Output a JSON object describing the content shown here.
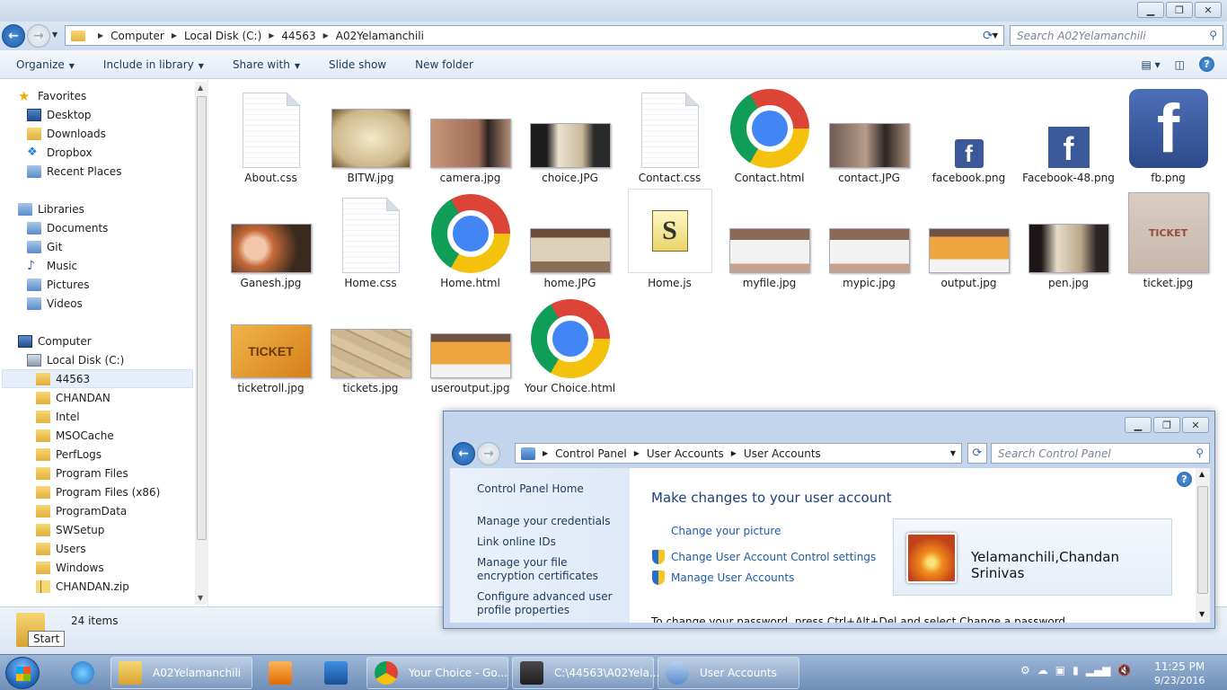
{
  "explorer": {
    "breadcrumbs": [
      "Computer",
      "Local Disk (C:)",
      "44563",
      "A02Yelamanchili"
    ],
    "search_placeholder": "Search A02Yelamanchili",
    "toolbar": {
      "organize": "Organize",
      "include_in_library": "Include in library",
      "share_with": "Share with",
      "slide_show": "Slide show",
      "new_folder": "New folder"
    },
    "nav": {
      "favorites": "Favorites",
      "desktop": "Desktop",
      "downloads": "Downloads",
      "dropbox": "Dropbox",
      "recent_places": "Recent Places",
      "libraries": "Libraries",
      "documents": "Documents",
      "git": "Git",
      "music": "Music",
      "pictures": "Pictures",
      "videos": "Videos",
      "computer": "Computer",
      "local_disk": "Local Disk (C:)",
      "folders": [
        "44563",
        "CHANDAN",
        "Intel",
        "MSOCache",
        "PerfLogs",
        "Program Files",
        "Program Files (x86)",
        "ProgramData",
        "SWSetup",
        "Users",
        "Windows",
        "CHANDAN.zip"
      ]
    },
    "files": [
      {
        "name": "About.css",
        "kind": "doc"
      },
      {
        "name": "BITW.jpg",
        "kind": "pic"
      },
      {
        "name": "camera.jpg",
        "kind": "pic"
      },
      {
        "name": "choice.JPG",
        "kind": "pic"
      },
      {
        "name": "Contact.css",
        "kind": "doc"
      },
      {
        "name": "Contact.html",
        "kind": "chrome"
      },
      {
        "name": "contact.JPG",
        "kind": "pic"
      },
      {
        "name": "facebook.png",
        "kind": "fbsm"
      },
      {
        "name": "Facebook-48.png",
        "kind": "fbmd"
      },
      {
        "name": "fb.png",
        "kind": "fblg"
      },
      {
        "name": "Ganesh.jpg",
        "kind": "pic"
      },
      {
        "name": "Home.css",
        "kind": "doc"
      },
      {
        "name": "Home.html",
        "kind": "chrome"
      },
      {
        "name": "home.JPG",
        "kind": "pic"
      },
      {
        "name": "Home.js",
        "kind": "js"
      },
      {
        "name": "myfile.jpg",
        "kind": "pic"
      },
      {
        "name": "mypic.jpg",
        "kind": "pic"
      },
      {
        "name": "output.jpg",
        "kind": "pic"
      },
      {
        "name": "pen.jpg",
        "kind": "pic"
      },
      {
        "name": "ticket.jpg",
        "kind": "pic"
      },
      {
        "name": "ticketroll.jpg",
        "kind": "ticket"
      },
      {
        "name": "tickets.jpg",
        "kind": "pic"
      },
      {
        "name": "useroutput.jpg",
        "kind": "pic"
      },
      {
        "name": "Your Choice.html",
        "kind": "chrome"
      }
    ],
    "item_count": "24 items",
    "tooltip": "Start"
  },
  "control_panel": {
    "breadcrumbs": [
      "Control Panel",
      "User Accounts",
      "User Accounts"
    ],
    "search_placeholder": "Search Control Panel",
    "side_links": {
      "home": "Control Panel Home",
      "credentials": "Manage your credentials",
      "online_ids": "Link online IDs",
      "encryption": "Manage your file encryption certificates",
      "advanced": "Configure advanced user profile properties"
    },
    "heading": "Make changes to your user account",
    "tasks": {
      "picture": "Change your picture",
      "uac": "Change User Account Control settings",
      "manage": "Manage User Accounts"
    },
    "user_name": "Yelamanchili,Chandan Srinivas",
    "password_hint": "To change your password, press Ctrl+Alt+Del and select Change a password."
  },
  "taskbar": {
    "items": [
      {
        "label": "A02Yelamanchili"
      },
      {
        "label": "Your Choice - Go..."
      },
      {
        "label": "C:\\44563\\A02Yela..."
      },
      {
        "label": "User Accounts"
      }
    ],
    "time": "11:25 PM",
    "date": "9/23/2016"
  },
  "colors": {
    "link_blue": "#1e5aa8",
    "heading_blue": "#1e3f7a",
    "taskbar": "#7f9dc3"
  }
}
